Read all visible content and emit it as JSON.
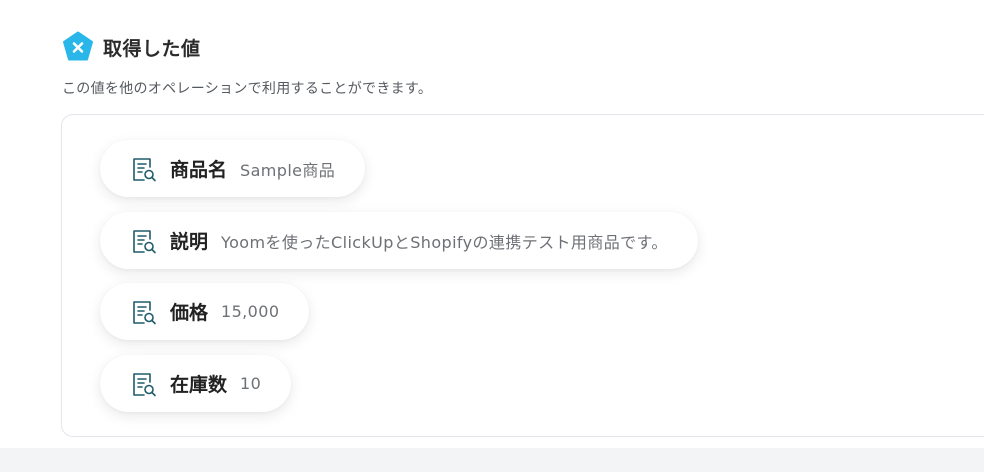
{
  "section": {
    "icon": "yoom-x-logo-icon",
    "accent_color": "#29b6e8",
    "title": "取得した値",
    "description": "この値を他のオペレーションで利用することができます。"
  },
  "values": [
    {
      "icon": "document-search-icon",
      "label": "商品名",
      "value": "Sample商品"
    },
    {
      "icon": "document-search-icon",
      "label": "説明",
      "value": "Yoomを使ったClickUpとShopifyの連携テスト用商品です。"
    },
    {
      "icon": "document-search-icon",
      "label": "価格",
      "value": "15,000"
    },
    {
      "icon": "document-search-icon",
      "label": "在庫数",
      "value": "10"
    }
  ],
  "colors": {
    "icon_stroke": "#1e5c6b",
    "chip_background": "#ffffff",
    "panel_border": "#e2e5ea"
  }
}
